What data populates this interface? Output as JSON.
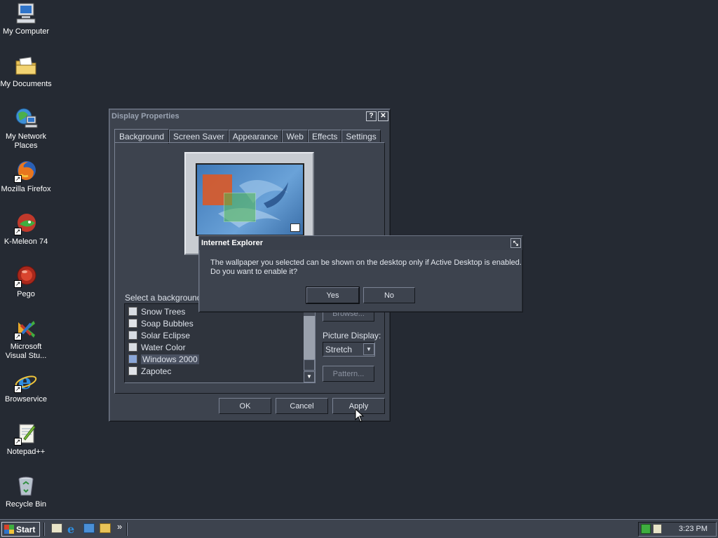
{
  "desktop": {
    "icons": [
      {
        "label": "My Computer",
        "icon": "computer-icon"
      },
      {
        "label": "My Documents",
        "icon": "folder-icon"
      },
      {
        "label": "My Network Places",
        "icon": "network-icon"
      },
      {
        "label": "Mozilla Firefox",
        "icon": "firefox-icon"
      },
      {
        "label": "K-Meleon 74",
        "icon": "kmeleon-icon"
      },
      {
        "label": "Pego",
        "icon": "pego-icon"
      },
      {
        "label": "Microsoft Visual Stu...",
        "icon": "visual-studio-icon"
      },
      {
        "label": "Browservice",
        "icon": "ie-icon"
      },
      {
        "label": "Notepad++",
        "icon": "notepad-icon"
      },
      {
        "label": "Recycle Bin",
        "icon": "recycle-bin-icon"
      }
    ]
  },
  "display_properties": {
    "title": "Display Properties",
    "tabs": [
      "Background",
      "Screen Saver",
      "Appearance",
      "Web",
      "Effects",
      "Settings"
    ],
    "list_label": "Select a background p",
    "wallpapers": [
      "Snow Trees",
      "Soap Bubbles",
      "Solar Eclipse",
      "Water Color",
      "Windows 2000",
      "Zapotec"
    ],
    "selected_wallpaper": "Windows 2000",
    "browse_label": "Browse...",
    "picture_display_label": "Picture Display:",
    "picture_display_value": "Stretch",
    "pattern_label": "Pattern...",
    "ok_label": "OK",
    "cancel_label": "Cancel",
    "apply_label": "Apply"
  },
  "dialog": {
    "title": "Internet Explorer",
    "message_line1": "The wallpaper you selected can be shown on the desktop only if Active Desktop is enabled.",
    "message_line2": "Do you want to enable it?",
    "yes_label": "Yes",
    "no_label": "No"
  },
  "taskbar": {
    "start_label": "Start",
    "more_label": "»",
    "clock": "3:23 PM"
  },
  "colors": {
    "desktop": "#252a33",
    "window": "#3d434e",
    "accent_red": "#d85a2a",
    "accent_green": "#52b84e",
    "accent_blue": "#3d7fc8"
  }
}
